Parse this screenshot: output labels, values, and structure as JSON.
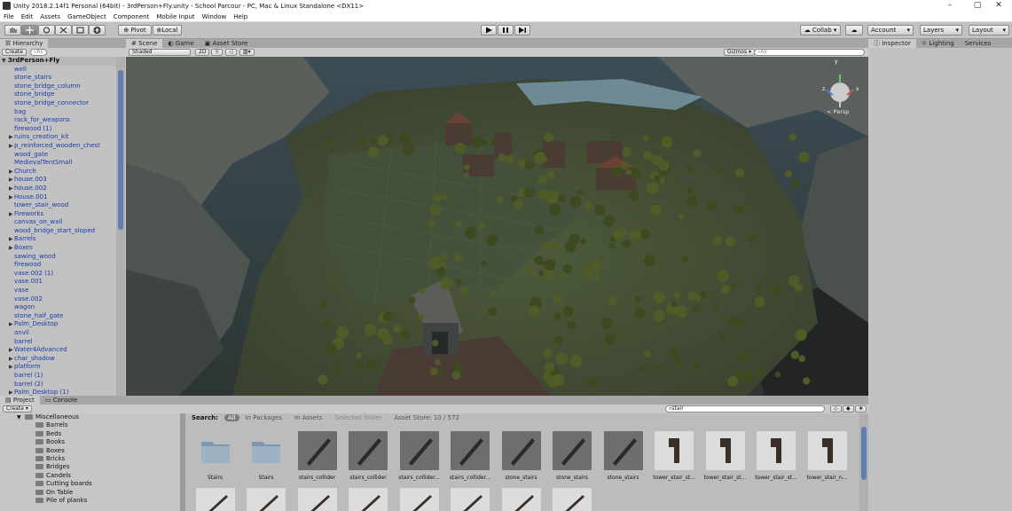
{
  "window": {
    "title": "Unity 2018.2.14f1 Personal (64bit) - 3rdPerson+Fly.unity - School Parcour - PC, Mac & Linux Standalone <DX11>",
    "controls": [
      "–",
      "▢",
      "✕"
    ]
  },
  "menu": [
    "File",
    "Edit",
    "Assets",
    "GameObject",
    "Component",
    "Mobile Input",
    "Window",
    "Help"
  ],
  "toolbar": {
    "tools": [
      "hand",
      "move",
      "rotate",
      "scale",
      "rect",
      "transform"
    ],
    "pivot_label": "Pivot",
    "local_label": "Local",
    "collab_label": "Collab ▾",
    "account_label": "Account",
    "layers_label": "Layers",
    "layout_label": "Layout"
  },
  "hierarchy": {
    "tab": "Hierarchy",
    "create_label": "Create",
    "search_placeholder": "All",
    "root": "3rdPerson+Fly",
    "items": [
      {
        "label": "well",
        "expandable": false
      },
      {
        "label": "stone_stairs",
        "expandable": false
      },
      {
        "label": "stone_bridge_column",
        "expandable": false
      },
      {
        "label": "stone_bridge",
        "expandable": false
      },
      {
        "label": "stone_bridge_connector",
        "expandable": false
      },
      {
        "label": "bag",
        "expandable": false
      },
      {
        "label": "rack_for_weapons",
        "expandable": false
      },
      {
        "label": "firewood (1)",
        "expandable": false
      },
      {
        "label": "ruins_creation_kit",
        "expandable": true
      },
      {
        "label": "p_reinforced_wooden_chest",
        "expandable": true
      },
      {
        "label": "wood_gate",
        "expandable": false
      },
      {
        "label": "MedievalTentSmall",
        "expandable": false
      },
      {
        "label": "Church",
        "expandable": true
      },
      {
        "label": "house.003",
        "expandable": true
      },
      {
        "label": "house.002",
        "expandable": true
      },
      {
        "label": "House.001",
        "expandable": true
      },
      {
        "label": "tower_stair_wood",
        "expandable": false
      },
      {
        "label": "Fireworks",
        "expandable": true
      },
      {
        "label": "canvas_on_wall",
        "expandable": false
      },
      {
        "label": "wood_bridge_start_sloped",
        "expandable": false
      },
      {
        "label": "Barrels",
        "expandable": true
      },
      {
        "label": "Boxes",
        "expandable": true
      },
      {
        "label": "sawing_wood",
        "expandable": false
      },
      {
        "label": "firewood",
        "expandable": false
      },
      {
        "label": "vase.002 (1)",
        "expandable": false
      },
      {
        "label": "vase.001",
        "expandable": false
      },
      {
        "label": "vase",
        "expandable": false
      },
      {
        "label": "vase.002",
        "expandable": false
      },
      {
        "label": "wagon",
        "expandable": false
      },
      {
        "label": "stone_half_gate",
        "expandable": false
      },
      {
        "label": "Palm_Desktop",
        "expandable": true
      },
      {
        "label": "anvil",
        "expandable": false
      },
      {
        "label": "barrel",
        "expandable": false
      },
      {
        "label": "Water4Advanced",
        "expandable": true
      },
      {
        "label": "char_shadow",
        "expandable": true
      },
      {
        "label": "platform",
        "expandable": true
      },
      {
        "label": "barrel (1)",
        "expandable": false
      },
      {
        "label": "barrel (2)",
        "expandable": false
      },
      {
        "label": "Palm_Desktop (1)",
        "expandable": true
      }
    ]
  },
  "scene": {
    "tabs": [
      "Scene",
      "Game",
      "Asset Store"
    ],
    "shading": "Shaded",
    "mode_2d": "2D",
    "gizmos_label": "Gizmos",
    "search_placeholder": "All",
    "persp_label": "< Persp",
    "axis_labels": [
      "y",
      "x",
      "z"
    ]
  },
  "inspector": {
    "tabs": [
      "Inspector",
      "Lighting",
      "Services"
    ]
  },
  "project": {
    "tabs": [
      "Project",
      "Console"
    ],
    "create_label": "Create",
    "search_value": "stair",
    "folders": [
      {
        "label": "Miscellaneous",
        "depth": 0,
        "open": true
      },
      {
        "label": "Barrels",
        "depth": 1
      },
      {
        "label": "Beds",
        "depth": 1
      },
      {
        "label": "Books",
        "depth": 1
      },
      {
        "label": "Boxes",
        "depth": 1
      },
      {
        "label": "Bricks",
        "depth": 1
      },
      {
        "label": "Bridges",
        "depth": 1
      },
      {
        "label": "Candels",
        "depth": 1
      },
      {
        "label": "Cutting boards",
        "depth": 1
      },
      {
        "label": "On Table",
        "depth": 1
      },
      {
        "label": "Pile of planks",
        "depth": 1
      }
    ],
    "search_scopes": {
      "search_label": "Search:",
      "all_label": "All",
      "in_packages": "In Packages",
      "in_assets": "In Assets",
      "selected_folder": "Selected folder",
      "asset_store": "Asset Store: 10 / 572"
    },
    "assets": [
      {
        "label": "Stairs",
        "kind": "folder"
      },
      {
        "label": "Stairs",
        "kind": "folder"
      },
      {
        "label": "stairs_collider",
        "kind": "mesh"
      },
      {
        "label": "stairs_collider",
        "kind": "mesh"
      },
      {
        "label": "stairs_collider...",
        "kind": "mesh"
      },
      {
        "label": "stairs_collider...",
        "kind": "mesh"
      },
      {
        "label": "stone_stairs",
        "kind": "mesh"
      },
      {
        "label": "stone_stairs",
        "kind": "mesh"
      },
      {
        "label": "stone_stairs",
        "kind": "mesh"
      },
      {
        "label": "tower_stair_st...",
        "kind": "model"
      },
      {
        "label": "tower_stair_st...",
        "kind": "model"
      },
      {
        "label": "tower_stair_st...",
        "kind": "model"
      },
      {
        "label": "tower_stair_n...",
        "kind": "model"
      }
    ]
  }
}
